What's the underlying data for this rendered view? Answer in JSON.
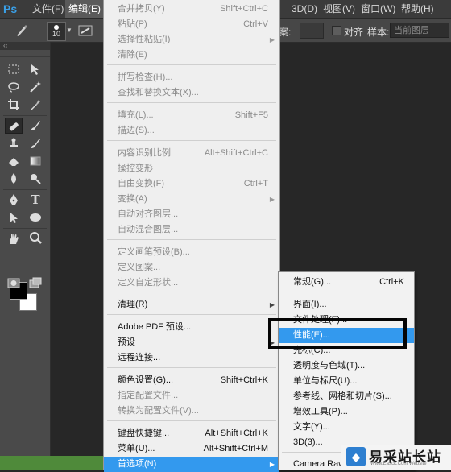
{
  "menubar": {
    "logo": "Ps",
    "items": [
      {
        "label": "文件(F)"
      },
      {
        "label": "编辑(E)",
        "active": true
      },
      {
        "label": "3D(D)"
      },
      {
        "label": "视图(V)"
      },
      {
        "label": "窗口(W)"
      },
      {
        "label": "帮助(H)"
      }
    ]
  },
  "options_bar": {
    "brush_size": "10",
    "sample_label": "案:",
    "align_label": "对齐",
    "sample_mode_label": "样本:",
    "sample_mode_value": "当前图层"
  },
  "tools_panel": {
    "header": "‹‹",
    "tools": [
      "move-tool",
      "marquee-tool",
      "lasso-tool",
      "magic-wand-tool",
      "crop-tool",
      "eyedropper-tool",
      "healing-brush-tool",
      "brush-tool",
      "clone-stamp-tool",
      "history-brush-tool",
      "eraser-tool",
      "gradient-tool",
      "blur-tool",
      "dodge-tool",
      "pen-tool",
      "type-tool",
      "path-selection-tool",
      "shape-tool",
      "hand-tool",
      "zoom-tool",
      "quick-mask",
      "screen-mode"
    ],
    "foreground_color": "#000000",
    "background_color": "#ffffff"
  },
  "edit_menu": {
    "items": [
      {
        "label": "合并拷贝(Y)",
        "shortcut": "Shift+Ctrl+C",
        "disabled": true
      },
      {
        "label": "粘贴(P)",
        "shortcut": "Ctrl+V",
        "disabled": true
      },
      {
        "label": "选择性粘贴(I)",
        "shortcut": "",
        "disabled": true,
        "submenu": true
      },
      {
        "label": "清除(E)",
        "shortcut": "",
        "disabled": true
      },
      {
        "separator": true
      },
      {
        "label": "拼写检查(H)...",
        "shortcut": "",
        "disabled": true
      },
      {
        "label": "查找和替换文本(X)...",
        "shortcut": "",
        "disabled": true
      },
      {
        "separator": true
      },
      {
        "label": "填充(L)...",
        "shortcut": "Shift+F5",
        "disabled": true
      },
      {
        "label": "描边(S)...",
        "shortcut": "",
        "disabled": true
      },
      {
        "separator": true
      },
      {
        "label": "内容识别比例",
        "shortcut": "Alt+Shift+Ctrl+C",
        "disabled": true
      },
      {
        "label": "操控变形",
        "shortcut": "",
        "disabled": true
      },
      {
        "label": "自由变换(F)",
        "shortcut": "Ctrl+T",
        "disabled": true
      },
      {
        "label": "变换(A)",
        "shortcut": "",
        "disabled": true,
        "submenu": true
      },
      {
        "label": "自动对齐图层...",
        "shortcut": "",
        "disabled": true
      },
      {
        "label": "自动混合图层...",
        "shortcut": "",
        "disabled": true
      },
      {
        "separator": true
      },
      {
        "label": "定义画笔预设(B)...",
        "shortcut": "",
        "disabled": true
      },
      {
        "label": "定义图案...",
        "shortcut": "",
        "disabled": true
      },
      {
        "label": "定义自定形状...",
        "shortcut": "",
        "disabled": true
      },
      {
        "separator": true
      },
      {
        "label": "清理(R)",
        "shortcut": "",
        "disabled": false,
        "submenu": true
      },
      {
        "separator": true
      },
      {
        "label": "Adobe PDF 预设...",
        "shortcut": "",
        "disabled": false
      },
      {
        "label": "预设",
        "shortcut": "",
        "disabled": false,
        "submenu": true
      },
      {
        "label": "远程连接...",
        "shortcut": "",
        "disabled": false
      },
      {
        "separator": true
      },
      {
        "label": "颜色设置(G)...",
        "shortcut": "Shift+Ctrl+K",
        "disabled": false
      },
      {
        "label": "指定配置文件...",
        "shortcut": "",
        "disabled": true
      },
      {
        "label": "转换为配置文件(V)...",
        "shortcut": "",
        "disabled": true
      },
      {
        "separator": true
      },
      {
        "label": "键盘快捷键...",
        "shortcut": "Alt+Shift+Ctrl+K",
        "disabled": false
      },
      {
        "label": "菜单(U)...",
        "shortcut": "Alt+Shift+Ctrl+M",
        "disabled": false
      },
      {
        "label": "首选项(N)",
        "shortcut": "",
        "disabled": false,
        "submenu": true,
        "highlighted": true
      }
    ]
  },
  "preferences_submenu": {
    "items": [
      {
        "label": "常规(G)...",
        "shortcut": "Ctrl+K"
      },
      {
        "separator": true
      },
      {
        "label": "界面(I)...",
        "shortcut": ""
      },
      {
        "label": "文件处理(F)...",
        "shortcut": ""
      },
      {
        "label": "性能(E)...",
        "shortcut": "",
        "highlighted": true
      },
      {
        "label": "光标(C)...",
        "shortcut": ""
      },
      {
        "label": "透明度与色域(T)...",
        "shortcut": ""
      },
      {
        "label": "单位与标尺(U)...",
        "shortcut": ""
      },
      {
        "label": "参考线、网格和切片(S)...",
        "shortcut": ""
      },
      {
        "label": "增效工具(P)...",
        "shortcut": ""
      },
      {
        "label": "文字(Y)...",
        "shortcut": ""
      },
      {
        "label": "3D(3)...",
        "shortcut": ""
      },
      {
        "separator": true
      },
      {
        "label": "Camera Raw...",
        "shortcut": ""
      }
    ]
  },
  "watermark": {
    "title": "易采站长站",
    "subtitle": "Www.Easck.Com Website"
  }
}
